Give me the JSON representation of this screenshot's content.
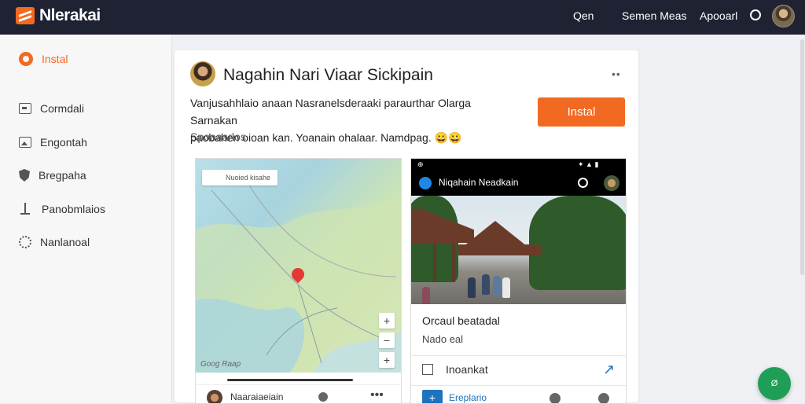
{
  "topbar": {
    "brand": "Nlerakai",
    "links": [
      "Qen",
      "Semen Meas",
      "Apooarl"
    ]
  },
  "sidebar": {
    "items": [
      {
        "label": "Instal",
        "icon": "gear-icon",
        "active": true
      },
      {
        "label": "Cormdali",
        "icon": "box-icon"
      },
      {
        "label": "Engontah",
        "icon": "image-icon"
      },
      {
        "label": "Bregpaha",
        "icon": "shield-icon"
      },
      {
        "label": "Panobmlaios",
        "icon": "pin-icon"
      },
      {
        "label": "Nanlanoal",
        "icon": "settings-icon"
      }
    ]
  },
  "app": {
    "title": "Nagahin Nari Viaar Sickipain",
    "description_line1": "Vanjusahhlaio anaan Nasranelsderaaki paraurthar Olarga Sarnakan",
    "description_line2": "paobahen oioan kan. Yoanain ohalaar. Namdpag. 😀😀",
    "install_label": "Instal",
    "more": "••",
    "screenshots_label": "Spoaaarlos"
  },
  "shot1": {
    "search_text": "Nuoied kisahe",
    "zoom_in": "+",
    "zoom_out": "−",
    "zoom_in2": "+",
    "watermark": "Goog Raap",
    "footer_text": "Naaraiaeiain",
    "footer_more": "•••"
  },
  "shot2": {
    "status_left": "⊕",
    "status_right": "✦ ▲ ▮",
    "title": "Niqahain Neadkain",
    "info_line1": "Orcaul beatadal",
    "info_line2": "Nado eal",
    "link_text": "Inoankat",
    "share": "↗",
    "bottom_plus": "+",
    "bottom_text": "Ereplario"
  },
  "colors": {
    "accent": "#f26a21",
    "topbar_bg": "#1f2233",
    "fab": "#1e9e56",
    "link_blue": "#1e73be"
  },
  "fab": {
    "label": "Ø"
  }
}
